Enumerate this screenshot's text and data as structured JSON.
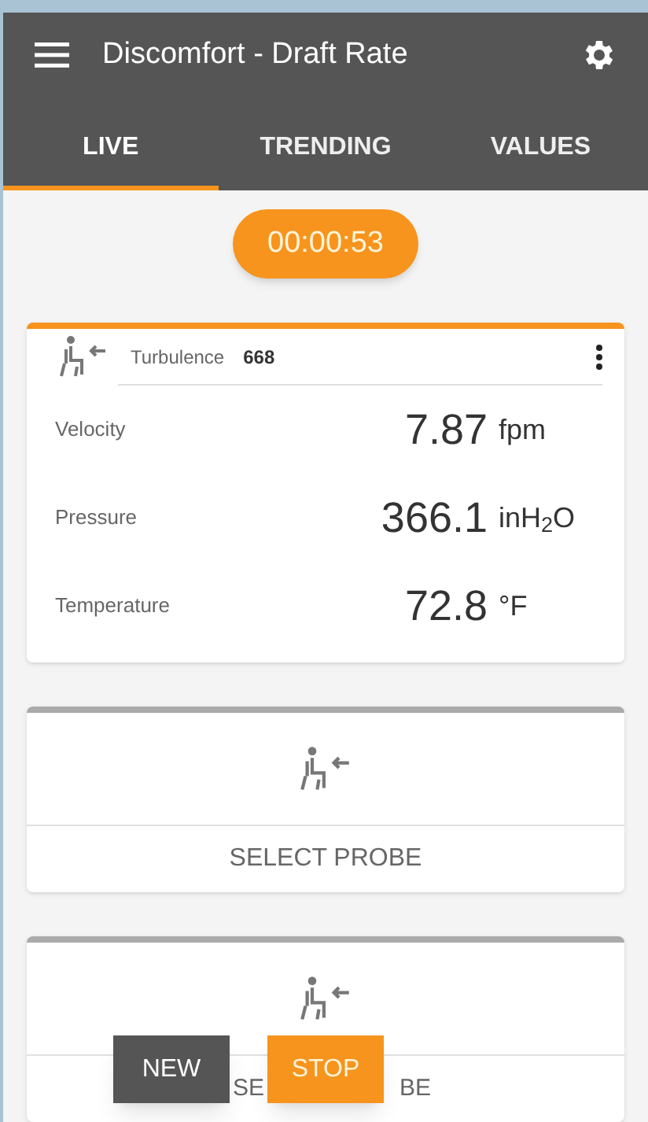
{
  "header": {
    "title": "Discomfort - Draft Rate"
  },
  "tabs": [
    {
      "label": "LIVE",
      "selected": true
    },
    {
      "label": "TRENDING",
      "selected": false
    },
    {
      "label": "VALUES",
      "selected": false
    }
  ],
  "timer": "00:00:53",
  "probe_card": {
    "active": true,
    "parameter_label": "Turbulence",
    "parameter_value": "668",
    "readings": [
      {
        "label": "Velocity",
        "value": "7.87",
        "unit": "fpm"
      },
      {
        "label": "Pressure",
        "value": "366.1",
        "unit": "inH$_{2}$O"
      },
      {
        "label": "Temperature",
        "value": "72.8",
        "unit": "°F"
      }
    ]
  },
  "empty_cards": [
    {
      "active": false,
      "label": "SELECT PROBE"
    },
    {
      "active": false,
      "label_start": "SE",
      "label_end": "BE"
    }
  ],
  "buttons": [
    {
      "label": "NEW",
      "kind": "secondary"
    },
    {
      "label": "STOP",
      "kind": "primary"
    }
  ]
}
